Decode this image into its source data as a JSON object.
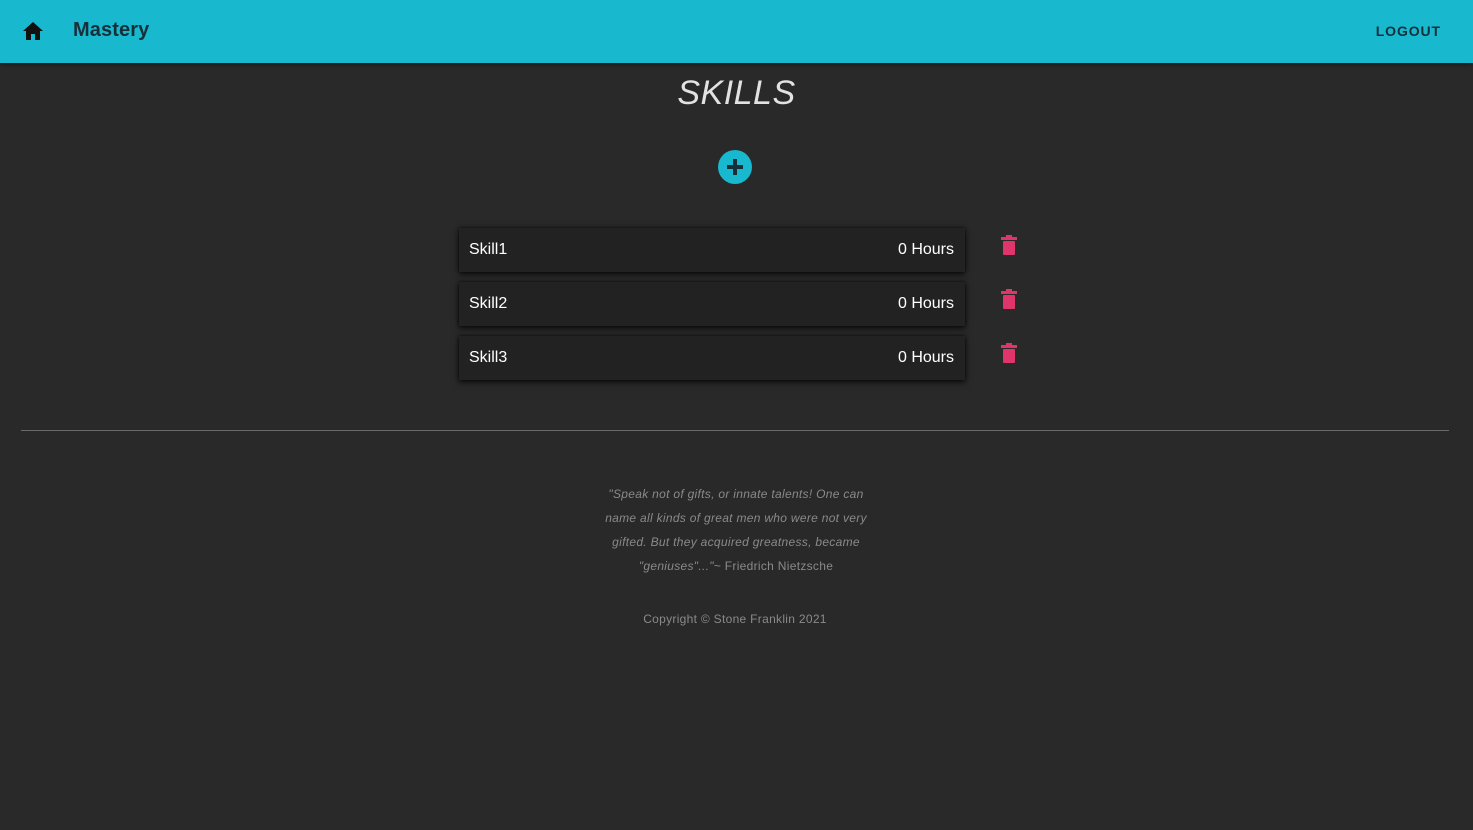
{
  "appbar": {
    "title": "Mastery",
    "home_icon": "home-icon",
    "logout_label": "LOGOUT"
  },
  "main": {
    "title": "SKILLS",
    "add_icon": "plus-circle-icon",
    "skills": [
      {
        "name": "Skill1",
        "hours": "0 Hours"
      },
      {
        "name": "Skill2",
        "hours": "0 Hours"
      },
      {
        "name": "Skill3",
        "hours": "0 Hours"
      }
    ],
    "delete_icon": "trash-icon"
  },
  "footer": {
    "quote": "\"Speak not of gifts, or innate talents! One can name all kinds of great men who were not very gifted. But they acquired greatness, became \"geniuses\"...\"",
    "quote_author": "~ Friedrich Nietzsche",
    "copyright": "Copyright © Stone Franklin 2021"
  },
  "colors": {
    "primary": "#18b8cf",
    "background": "#292929",
    "card": "#222222",
    "delete": "#e0356a"
  }
}
